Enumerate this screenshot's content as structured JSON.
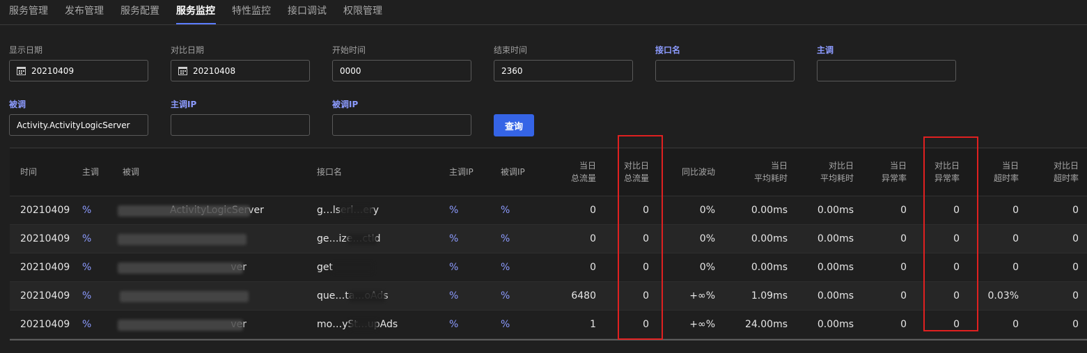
{
  "tabs": [
    "服务管理",
    "发布管理",
    "服务配置",
    "服务监控",
    "特性监控",
    "接口调试",
    "权限管理"
  ],
  "filters": {
    "display_date": {
      "label": "显示日期",
      "value": "20210409"
    },
    "compare_date": {
      "label": "对比日期",
      "value": "20210408"
    },
    "start_time": {
      "label": "开始时间",
      "value": "0000"
    },
    "end_time": {
      "label": "结束时间",
      "value": "2360"
    },
    "interface_name": {
      "label": "接口名",
      "value": ""
    },
    "caller": {
      "label": "主调",
      "value": ""
    },
    "callee": {
      "label": "被调",
      "value": "Activity.ActivityLogicServer"
    },
    "caller_ip": {
      "label": "主调IP",
      "value": ""
    },
    "callee_ip": {
      "label": "被调IP",
      "value": ""
    },
    "query_button": "查询"
  },
  "table": {
    "headers": [
      "时间",
      "主调",
      "被调",
      "接口名",
      "主调IP",
      "被调IP",
      "当日\n总流量",
      "对比日\n总流量",
      "同比波动",
      "当日\n平均耗时",
      "对比日\n平均耗时",
      "当日\n异常率",
      "对比日\n异常率",
      "当日\n超时率",
      "对比日\n超时率"
    ],
    "header_lines": [
      [
        "时间"
      ],
      [
        "主调"
      ],
      [
        "被调"
      ],
      [
        "接口名"
      ],
      [
        "主调IP"
      ],
      [
        "被调IP"
      ],
      [
        "当日",
        "总流量"
      ],
      [
        "对比日",
        "总流量"
      ],
      [
        "同比波动"
      ],
      [
        "当日",
        "平均耗时"
      ],
      [
        "对比日",
        "平均耗时"
      ],
      [
        "当日",
        "异常率"
      ],
      [
        "对比日",
        "异常率"
      ],
      [
        "当日",
        "超时率"
      ],
      [
        "对比日",
        "超时率"
      ]
    ],
    "rows": [
      {
        "time": "20210409",
        "caller": "%",
        "callee": "ActivityLogicServer",
        "iface": "g…lserl…ery",
        "caller_ip": "%",
        "callee_ip": "%",
        "today_flow": "0",
        "cmp_flow": "0",
        "yoy": "0%",
        "today_avg": "0.00ms",
        "cmp_avg": "0.00ms",
        "today_err": "0",
        "cmp_err": "0",
        "today_to": "0",
        "cmp_to": "0"
      },
      {
        "time": "20210409",
        "caller": "%",
        "callee": "",
        "iface": "ge…ize…ctId",
        "caller_ip": "%",
        "callee_ip": "%",
        "today_flow": "0",
        "cmp_flow": "0",
        "yoy": "0%",
        "today_avg": "0.00ms",
        "cmp_avg": "0.00ms",
        "today_err": "0",
        "cmp_err": "0",
        "today_to": "0",
        "cmp_to": "0"
      },
      {
        "time": "20210409",
        "caller": "%",
        "callee": "ver",
        "iface": "get",
        "caller_ip": "%",
        "callee_ip": "%",
        "today_flow": "0",
        "cmp_flow": "0",
        "yoy": "0%",
        "today_avg": "0.00ms",
        "cmp_avg": "0.00ms",
        "today_err": "0",
        "cmp_err": "0",
        "today_to": "0",
        "cmp_to": "0"
      },
      {
        "time": "20210409",
        "caller": "%",
        "callee": "",
        "iface": "que…ta…oAds",
        "caller_ip": "%",
        "callee_ip": "%",
        "today_flow": "6480",
        "cmp_flow": "0",
        "yoy": "+∞%",
        "today_avg": "1.09ms",
        "cmp_avg": "0.00ms",
        "today_err": "0",
        "cmp_err": "0",
        "today_to": "0.03%",
        "cmp_to": "0"
      },
      {
        "time": "20210409",
        "caller": "%",
        "callee": "ver",
        "iface": "mo…ySt…upAds",
        "caller_ip": "%",
        "callee_ip": "%",
        "today_flow": "1",
        "cmp_flow": "0",
        "yoy": "+∞%",
        "today_avg": "24.00ms",
        "cmp_avg": "0.00ms",
        "today_err": "0",
        "cmp_err": "0",
        "today_to": "0",
        "cmp_to": "0"
      }
    ]
  },
  "colors": {
    "accent": "#5b7cff",
    "button": "#3564e6",
    "highlight_box": "#e02020",
    "link": "#8c9bff"
  }
}
